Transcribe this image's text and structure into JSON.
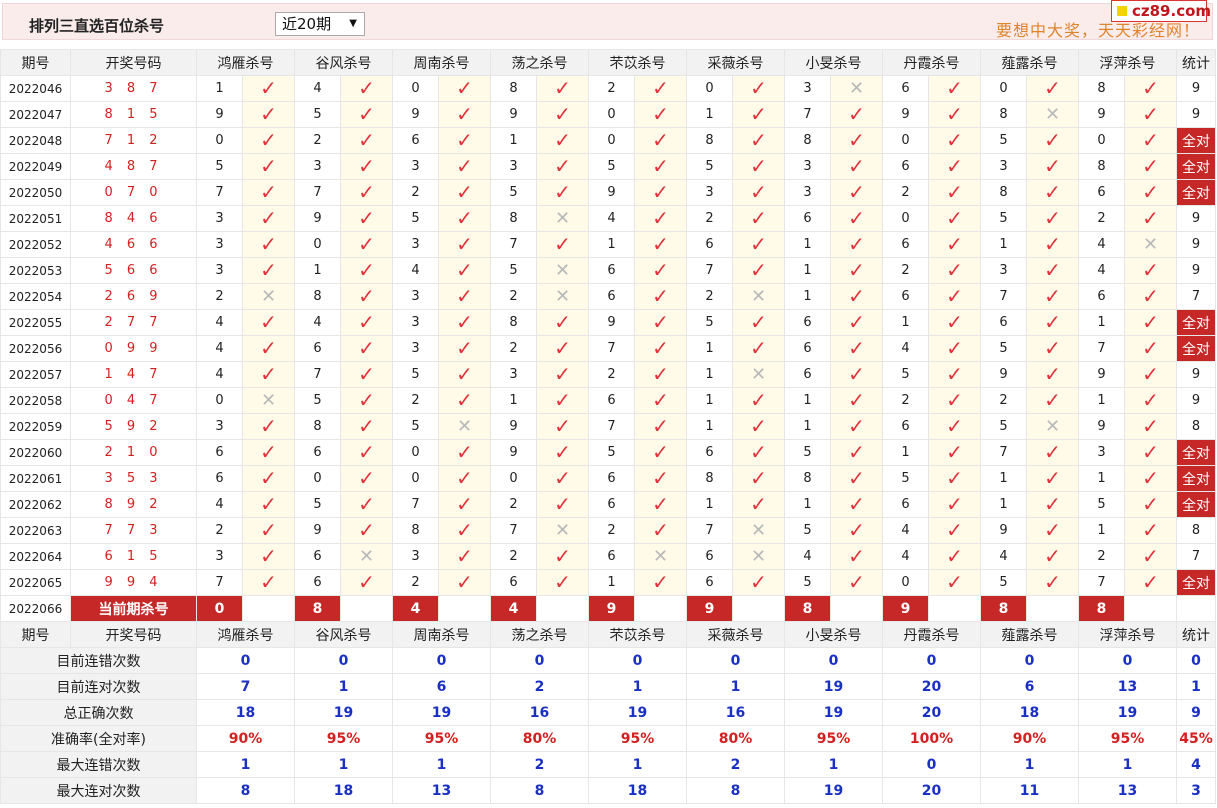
{
  "header": {
    "title": "排列三直选百位杀号",
    "period_select": "近20期",
    "promo": "要想中大奖，天天彩经网！",
    "logo": "cz89.com"
  },
  "columns": {
    "issue": "期号",
    "draw": "开奖号码",
    "experts": [
      "鸿雁杀号",
      "谷风杀号",
      "周南杀号",
      "荡之杀号",
      "芣苡杀号",
      "采薇杀号",
      "小旻杀号",
      "丹霞杀号",
      "薤露杀号",
      "浮萍杀号"
    ],
    "stat": "统计"
  },
  "symbols": {
    "ok": "✓",
    "no": "✕",
    "full": "全对"
  },
  "rows": [
    {
      "issue": "2022046",
      "draw": "3 8 7",
      "picks": [
        [
          1,
          1
        ],
        [
          4,
          1
        ],
        [
          0,
          1
        ],
        [
          8,
          1
        ],
        [
          2,
          1
        ],
        [
          0,
          1
        ],
        [
          3,
          0
        ],
        [
          6,
          1
        ],
        [
          0,
          1
        ],
        [
          8,
          1
        ]
      ],
      "stat": "9"
    },
    {
      "issue": "2022047",
      "draw": "8 1 5",
      "picks": [
        [
          9,
          1
        ],
        [
          5,
          1
        ],
        [
          9,
          1
        ],
        [
          9,
          1
        ],
        [
          0,
          1
        ],
        [
          1,
          1
        ],
        [
          7,
          1
        ],
        [
          9,
          1
        ],
        [
          8,
          0
        ],
        [
          9,
          1
        ]
      ],
      "stat": "9"
    },
    {
      "issue": "2022048",
      "draw": "7 1 2",
      "picks": [
        [
          0,
          1
        ],
        [
          2,
          1
        ],
        [
          6,
          1
        ],
        [
          1,
          1
        ],
        [
          0,
          1
        ],
        [
          8,
          1
        ],
        [
          8,
          1
        ],
        [
          0,
          1
        ],
        [
          5,
          1
        ],
        [
          0,
          1
        ]
      ],
      "stat": "全对"
    },
    {
      "issue": "2022049",
      "draw": "4 8 7",
      "picks": [
        [
          5,
          1
        ],
        [
          3,
          1
        ],
        [
          3,
          1
        ],
        [
          3,
          1
        ],
        [
          5,
          1
        ],
        [
          5,
          1
        ],
        [
          3,
          1
        ],
        [
          6,
          1
        ],
        [
          3,
          1
        ],
        [
          8,
          1
        ]
      ],
      "stat": "全对"
    },
    {
      "issue": "2022050",
      "draw": "0 7 0",
      "picks": [
        [
          7,
          1
        ],
        [
          7,
          1
        ],
        [
          2,
          1
        ],
        [
          5,
          1
        ],
        [
          9,
          1
        ],
        [
          3,
          1
        ],
        [
          3,
          1
        ],
        [
          2,
          1
        ],
        [
          8,
          1
        ],
        [
          6,
          1
        ]
      ],
      "stat": "全对"
    },
    {
      "issue": "2022051",
      "draw": "8 4 6",
      "picks": [
        [
          3,
          1
        ],
        [
          9,
          1
        ],
        [
          5,
          1
        ],
        [
          8,
          0
        ],
        [
          4,
          1
        ],
        [
          2,
          1
        ],
        [
          6,
          1
        ],
        [
          0,
          1
        ],
        [
          5,
          1
        ],
        [
          2,
          1
        ]
      ],
      "stat": "9"
    },
    {
      "issue": "2022052",
      "draw": "4 6 6",
      "picks": [
        [
          3,
          1
        ],
        [
          0,
          1
        ],
        [
          3,
          1
        ],
        [
          7,
          1
        ],
        [
          1,
          1
        ],
        [
          6,
          1
        ],
        [
          1,
          1
        ],
        [
          6,
          1
        ],
        [
          1,
          1
        ],
        [
          4,
          0
        ]
      ],
      "stat": "9"
    },
    {
      "issue": "2022053",
      "draw": "5 6 6",
      "picks": [
        [
          3,
          1
        ],
        [
          1,
          1
        ],
        [
          4,
          1
        ],
        [
          5,
          0
        ],
        [
          6,
          1
        ],
        [
          7,
          1
        ],
        [
          1,
          1
        ],
        [
          2,
          1
        ],
        [
          3,
          1
        ],
        [
          4,
          1
        ]
      ],
      "stat": "9"
    },
    {
      "issue": "2022054",
      "draw": "2 6 9",
      "picks": [
        [
          2,
          0
        ],
        [
          8,
          1
        ],
        [
          3,
          1
        ],
        [
          2,
          0
        ],
        [
          6,
          1
        ],
        [
          2,
          0
        ],
        [
          1,
          1
        ],
        [
          6,
          1
        ],
        [
          7,
          1
        ],
        [
          6,
          1
        ]
      ],
      "stat": "7"
    },
    {
      "issue": "2022055",
      "draw": "2 7 7",
      "picks": [
        [
          4,
          1
        ],
        [
          4,
          1
        ],
        [
          3,
          1
        ],
        [
          8,
          1
        ],
        [
          9,
          1
        ],
        [
          5,
          1
        ],
        [
          6,
          1
        ],
        [
          1,
          1
        ],
        [
          6,
          1
        ],
        [
          1,
          1
        ]
      ],
      "stat": "全对"
    },
    {
      "issue": "2022056",
      "draw": "0 9 9",
      "picks": [
        [
          4,
          1
        ],
        [
          6,
          1
        ],
        [
          3,
          1
        ],
        [
          2,
          1
        ],
        [
          7,
          1
        ],
        [
          1,
          1
        ],
        [
          6,
          1
        ],
        [
          4,
          1
        ],
        [
          5,
          1
        ],
        [
          7,
          1
        ]
      ],
      "stat": "全对"
    },
    {
      "issue": "2022057",
      "draw": "1 4 7",
      "picks": [
        [
          4,
          1
        ],
        [
          7,
          1
        ],
        [
          5,
          1
        ],
        [
          3,
          1
        ],
        [
          2,
          1
        ],
        [
          1,
          0
        ],
        [
          6,
          1
        ],
        [
          5,
          1
        ],
        [
          9,
          1
        ],
        [
          9,
          1
        ]
      ],
      "stat": "9"
    },
    {
      "issue": "2022058",
      "draw": "0 4 7",
      "picks": [
        [
          0,
          0
        ],
        [
          5,
          1
        ],
        [
          2,
          1
        ],
        [
          1,
          1
        ],
        [
          6,
          1
        ],
        [
          1,
          1
        ],
        [
          1,
          1
        ],
        [
          2,
          1
        ],
        [
          2,
          1
        ],
        [
          1,
          1
        ]
      ],
      "stat": "9"
    },
    {
      "issue": "2022059",
      "draw": "5 9 2",
      "picks": [
        [
          3,
          1
        ],
        [
          8,
          1
        ],
        [
          5,
          0
        ],
        [
          9,
          1
        ],
        [
          7,
          1
        ],
        [
          1,
          1
        ],
        [
          1,
          1
        ],
        [
          6,
          1
        ],
        [
          5,
          0
        ],
        [
          9,
          1
        ]
      ],
      "stat": "8"
    },
    {
      "issue": "2022060",
      "draw": "2 1 0",
      "picks": [
        [
          6,
          1
        ],
        [
          6,
          1
        ],
        [
          0,
          1
        ],
        [
          9,
          1
        ],
        [
          5,
          1
        ],
        [
          6,
          1
        ],
        [
          5,
          1
        ],
        [
          1,
          1
        ],
        [
          7,
          1
        ],
        [
          3,
          1
        ]
      ],
      "stat": "全对"
    },
    {
      "issue": "2022061",
      "draw": "3 5 3",
      "picks": [
        [
          6,
          1
        ],
        [
          0,
          1
        ],
        [
          0,
          1
        ],
        [
          0,
          1
        ],
        [
          6,
          1
        ],
        [
          8,
          1
        ],
        [
          8,
          1
        ],
        [
          5,
          1
        ],
        [
          1,
          1
        ],
        [
          1,
          1
        ]
      ],
      "stat": "全对"
    },
    {
      "issue": "2022062",
      "draw": "8 9 2",
      "picks": [
        [
          4,
          1
        ],
        [
          5,
          1
        ],
        [
          7,
          1
        ],
        [
          2,
          1
        ],
        [
          6,
          1
        ],
        [
          1,
          1
        ],
        [
          1,
          1
        ],
        [
          6,
          1
        ],
        [
          1,
          1
        ],
        [
          5,
          1
        ]
      ],
      "stat": "全对"
    },
    {
      "issue": "2022063",
      "draw": "7 7 3",
      "picks": [
        [
          2,
          1
        ],
        [
          9,
          1
        ],
        [
          8,
          1
        ],
        [
          7,
          0
        ],
        [
          2,
          1
        ],
        [
          7,
          0
        ],
        [
          5,
          1
        ],
        [
          4,
          1
        ],
        [
          9,
          1
        ],
        [
          1,
          1
        ]
      ],
      "stat": "8"
    },
    {
      "issue": "2022064",
      "draw": "6 1 5",
      "picks": [
        [
          3,
          1
        ],
        [
          6,
          0
        ],
        [
          3,
          1
        ],
        [
          2,
          1
        ],
        [
          6,
          0
        ],
        [
          6,
          0
        ],
        [
          4,
          1
        ],
        [
          4,
          1
        ],
        [
          4,
          1
        ],
        [
          2,
          1
        ]
      ],
      "stat": "7"
    },
    {
      "issue": "2022065",
      "draw": "9 9 4",
      "picks": [
        [
          7,
          1
        ],
        [
          6,
          1
        ],
        [
          2,
          1
        ],
        [
          6,
          1
        ],
        [
          1,
          1
        ],
        [
          6,
          1
        ],
        [
          5,
          1
        ],
        [
          0,
          1
        ],
        [
          5,
          1
        ],
        [
          7,
          1
        ]
      ],
      "stat": "全对"
    }
  ],
  "current": {
    "issue": "2022066",
    "label": "当前期杀号",
    "kills": [
      "0",
      "8",
      "4",
      "4",
      "9",
      "9",
      "8",
      "9",
      "8",
      "8"
    ]
  },
  "stats": [
    {
      "label": "目前连错次数",
      "values": [
        "0",
        "0",
        "0",
        "0",
        "0",
        "0",
        "0",
        "0",
        "0",
        "0"
      ],
      "total": "0",
      "style": "v"
    },
    {
      "label": "目前连对次数",
      "values": [
        "7",
        "1",
        "6",
        "2",
        "1",
        "1",
        "19",
        "20",
        "6",
        "13"
      ],
      "total": "1",
      "style": "v"
    },
    {
      "label": "总正确次数",
      "values": [
        "18",
        "19",
        "19",
        "16",
        "19",
        "16",
        "19",
        "20",
        "18",
        "19"
      ],
      "total": "9",
      "style": "v"
    },
    {
      "label": "准确率(全对率)",
      "values": [
        "90%",
        "95%",
        "95%",
        "80%",
        "95%",
        "80%",
        "95%",
        "100%",
        "90%",
        "95%"
      ],
      "total": "45%",
      "style": "rate"
    },
    {
      "label": "最大连错次数",
      "values": [
        "1",
        "1",
        "1",
        "2",
        "1",
        "2",
        "1",
        "0",
        "1",
        "1"
      ],
      "total": "4",
      "style": "v"
    },
    {
      "label": "最大连对次数",
      "values": [
        "8",
        "18",
        "13",
        "8",
        "18",
        "8",
        "19",
        "20",
        "11",
        "13"
      ],
      "total": "3",
      "style": "v"
    }
  ]
}
